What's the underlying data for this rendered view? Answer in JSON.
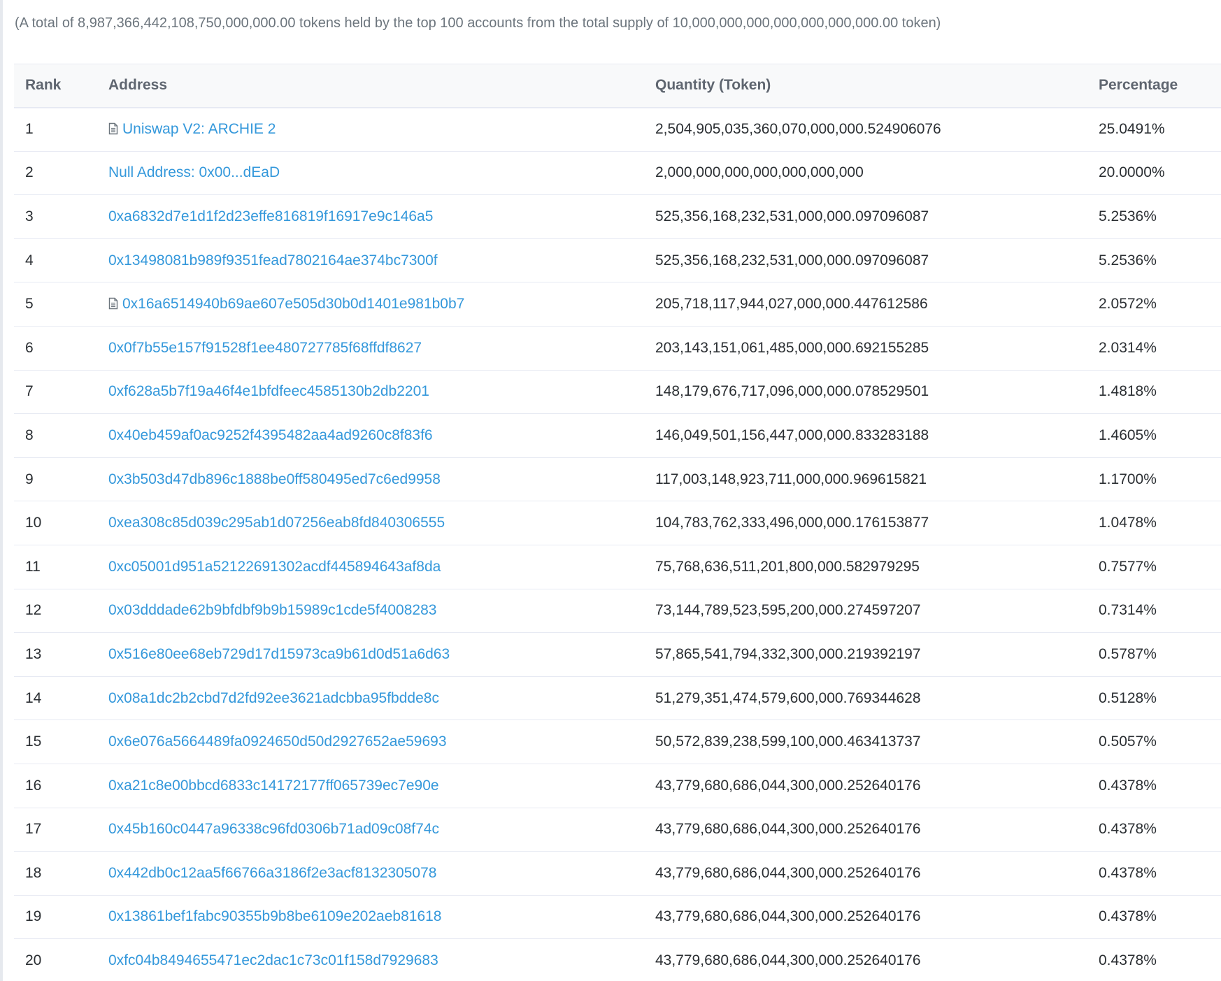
{
  "summary": "(A total of 8,987,366,442,108,750,000,000.00 tokens held by the top 100 accounts from the total supply of 10,000,000,000,000,000,000,000.00 token)",
  "columns": {
    "rank": "Rank",
    "address": "Address",
    "quantity": "Quantity (Token)",
    "percentage": "Percentage"
  },
  "accent": "#3498db",
  "rows": [
    {
      "rank": "1",
      "address": "Uniswap V2: ARCHIE 2",
      "contract": true,
      "quantity": "2,504,905,035,360,070,000,000.524906076",
      "percentage": "25.0491%"
    },
    {
      "rank": "2",
      "address": "Null Address: 0x00...dEaD",
      "contract": false,
      "quantity": "2,000,000,000,000,000,000,000",
      "percentage": "20.0000%"
    },
    {
      "rank": "3",
      "address": "0xa6832d7e1d1f2d23effe816819f16917e9c146a5",
      "contract": false,
      "quantity": "525,356,168,232,531,000,000.097096087",
      "percentage": "5.2536%"
    },
    {
      "rank": "4",
      "address": "0x13498081b989f9351fead7802164ae374bc7300f",
      "contract": false,
      "quantity": "525,356,168,232,531,000,000.097096087",
      "percentage": "5.2536%"
    },
    {
      "rank": "5",
      "address": "0x16a6514940b69ae607e505d30b0d1401e981b0b7",
      "contract": true,
      "quantity": "205,718,117,944,027,000,000.447612586",
      "percentage": "2.0572%"
    },
    {
      "rank": "6",
      "address": "0x0f7b55e157f91528f1ee480727785f68ffdf8627",
      "contract": false,
      "quantity": "203,143,151,061,485,000,000.692155285",
      "percentage": "2.0314%"
    },
    {
      "rank": "7",
      "address": "0xf628a5b7f19a46f4e1bfdfeec4585130b2db2201",
      "contract": false,
      "quantity": "148,179,676,717,096,000,000.078529501",
      "percentage": "1.4818%"
    },
    {
      "rank": "8",
      "address": "0x40eb459af0ac9252f4395482aa4ad9260c8f83f6",
      "contract": false,
      "quantity": "146,049,501,156,447,000,000.833283188",
      "percentage": "1.4605%"
    },
    {
      "rank": "9",
      "address": "0x3b503d47db896c1888be0ff580495ed7c6ed9958",
      "contract": false,
      "quantity": "117,003,148,923,711,000,000.969615821",
      "percentage": "1.1700%"
    },
    {
      "rank": "10",
      "address": "0xea308c85d039c295ab1d07256eab8fd840306555",
      "contract": false,
      "quantity": "104,783,762,333,496,000,000.176153877",
      "percentage": "1.0478%"
    },
    {
      "rank": "11",
      "address": "0xc05001d951a52122691302acdf445894643af8da",
      "contract": false,
      "quantity": "75,768,636,511,201,800,000.582979295",
      "percentage": "0.7577%"
    },
    {
      "rank": "12",
      "address": "0x03dddade62b9bfdbf9b9b15989c1cde5f4008283",
      "contract": false,
      "quantity": "73,144,789,523,595,200,000.274597207",
      "percentage": "0.7314%"
    },
    {
      "rank": "13",
      "address": "0x516e80ee68eb729d17d15973ca9b61d0d51a6d63",
      "contract": false,
      "quantity": "57,865,541,794,332,300,000.219392197",
      "percentage": "0.5787%"
    },
    {
      "rank": "14",
      "address": "0x08a1dc2b2cbd7d2fd92ee3621adcbba95fbdde8c",
      "contract": false,
      "quantity": "51,279,351,474,579,600,000.769344628",
      "percentage": "0.5128%"
    },
    {
      "rank": "15",
      "address": "0x6e076a5664489fa0924650d50d2927652ae59693",
      "contract": false,
      "quantity": "50,572,839,238,599,100,000.463413737",
      "percentage": "0.5057%"
    },
    {
      "rank": "16",
      "address": "0xa21c8e00bbcd6833c14172177ff065739ec7e90e",
      "contract": false,
      "quantity": "43,779,680,686,044,300,000.252640176",
      "percentage": "0.4378%"
    },
    {
      "rank": "17",
      "address": "0x45b160c0447a96338c96fd0306b71ad09c08f74c",
      "contract": false,
      "quantity": "43,779,680,686,044,300,000.252640176",
      "percentage": "0.4378%"
    },
    {
      "rank": "18",
      "address": "0x442db0c12aa5f66766a3186f2e3acf8132305078",
      "contract": false,
      "quantity": "43,779,680,686,044,300,000.252640176",
      "percentage": "0.4378%"
    },
    {
      "rank": "19",
      "address": "0x13861bef1fabc90355b9b8be6109e202aeb81618",
      "contract": false,
      "quantity": "43,779,680,686,044,300,000.252640176",
      "percentage": "0.4378%"
    },
    {
      "rank": "20",
      "address": "0xfc04b8494655471ec2dac1c73c01f158d7929683",
      "contract": false,
      "quantity": "43,779,680,686,044,300,000.252640176",
      "percentage": "0.4378%"
    }
  ]
}
